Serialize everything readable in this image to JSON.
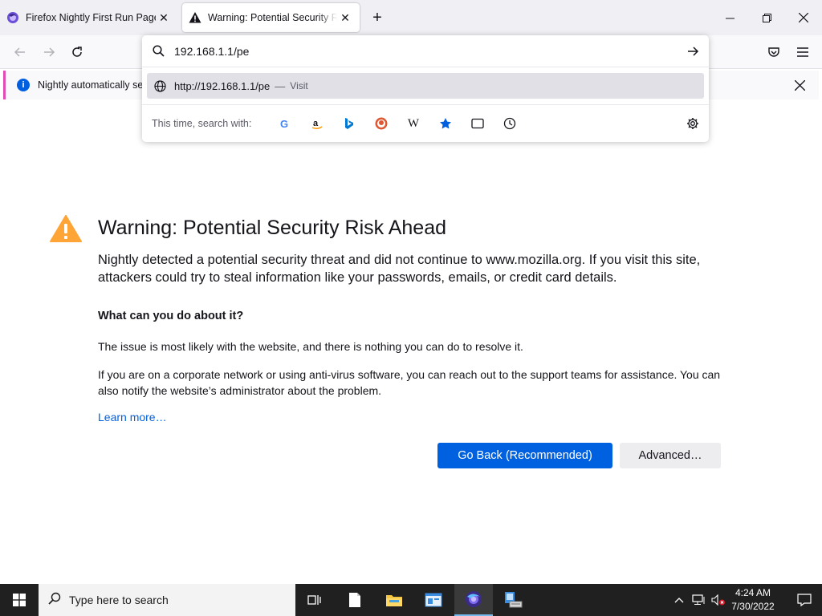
{
  "tabs": [
    {
      "title": "Firefox Nightly First Run Page",
      "favicon": "firefox-nightly-icon",
      "active": false
    },
    {
      "title": "Warning: Potential Security Risk Ahead",
      "favicon": "warning-icon",
      "active": true
    }
  ],
  "urlbar": {
    "value": "192.168.1.1/pe",
    "suggestion_url": "http://192.168.1.1/pe",
    "suggestion_sep": "—",
    "suggestion_action": "Visit",
    "search_with_label": "This time, search with:",
    "engines": [
      "google-icon",
      "amazon-icon",
      "bing-icon",
      "duckduckgo-icon",
      "wikipedia-icon",
      "bookmarks-icon",
      "tabs-icon",
      "history-icon"
    ]
  },
  "notification": {
    "text": "Nightly automatically ser"
  },
  "error": {
    "title": "Warning: Potential Security Risk Ahead",
    "intro": "Nightly detected a potential security threat and did not continue to www.mozilla.org. If you visit this site, attackers could try to steal information like your passwords, emails, or credit card details.",
    "subheading": "What can you do about it?",
    "paragraph1": "The issue is most likely with the website, and there is nothing you can do to resolve it.",
    "paragraph2": "If you are on a corporate network or using anti-virus software, you can reach out to the support teams for assistance. You can also notify the website’s administrator about the problem.",
    "learn_more": "Learn more…",
    "go_back": "Go Back (Recommended)",
    "advanced": "Advanced…"
  },
  "taskbar": {
    "search_placeholder": "Type here to search",
    "time": "4:24 AM",
    "date": "7/30/2022"
  },
  "colors": {
    "accent": "#0061e0",
    "warning": "#ffa436",
    "notification_bar": "#e04bb5",
    "taskbar": "#202020"
  }
}
